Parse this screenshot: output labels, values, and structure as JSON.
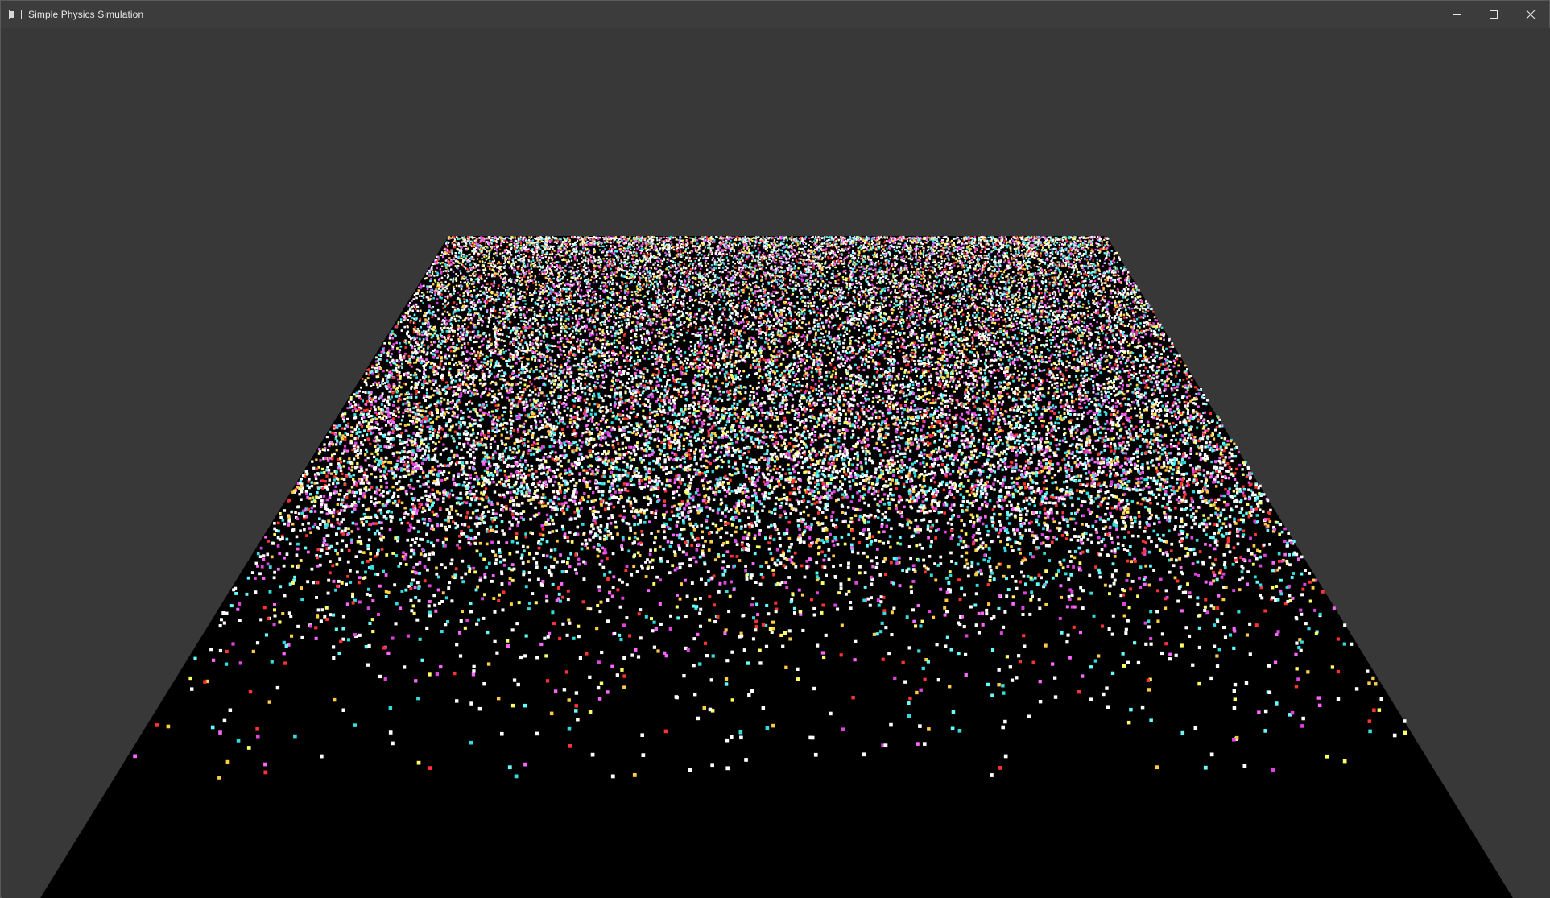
{
  "window": {
    "title": "Simple Physics Simulation",
    "controls": {
      "minimize_icon": "minimize-icon",
      "maximize_icon": "maximize-icon",
      "close_icon": "close-icon"
    }
  },
  "scene": {
    "background_color": "#383838",
    "floor_color": "#000000",
    "particle_colors": [
      "#ffffff",
      "#ffffff",
      "#ffffff",
      "#ffffff",
      "#ffffff",
      "#ffff66",
      "#66ffff",
      "#ff66ff",
      "#ffcc44",
      "#33dddd",
      "#dd44dd",
      "#ff3333"
    ]
  }
}
